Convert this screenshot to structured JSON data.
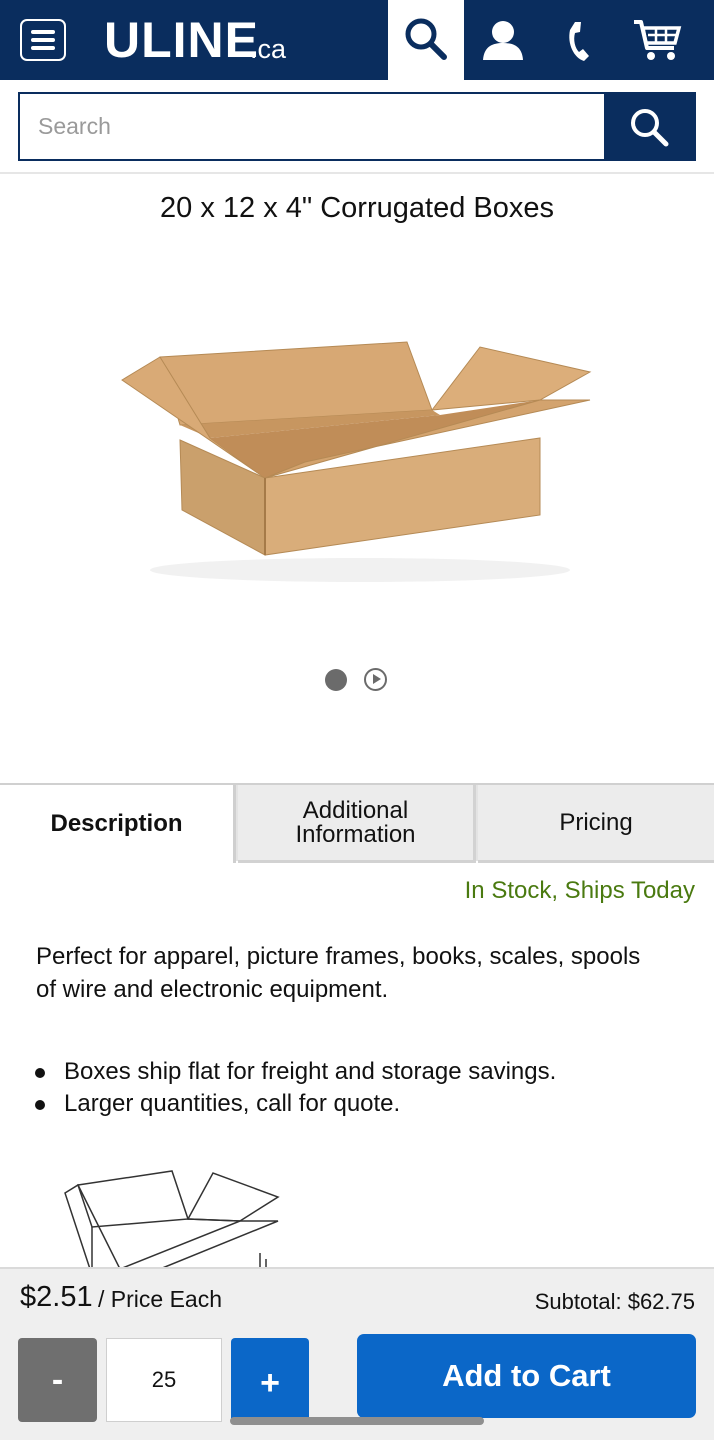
{
  "header": {
    "logo_text": "ULINE",
    "logo_suffix": ".ca",
    "icons": [
      "menu-icon",
      "search-icon",
      "account-icon",
      "phone-icon",
      "cart-icon"
    ],
    "brand_color": "#0a2d5e"
  },
  "search": {
    "placeholder": "Search",
    "value": ""
  },
  "product": {
    "title": "20 x 12 x 4\" Corrugated Boxes",
    "image": "cardboard-box-image",
    "carousel": {
      "slides": [
        "image",
        "video"
      ],
      "active_index": 0
    }
  },
  "tabs": [
    {
      "label": "Description",
      "active": true
    },
    {
      "label": "Additional Information",
      "active": false
    },
    {
      "label": "Pricing",
      "active": false
    }
  ],
  "details": {
    "stock_status": "In Stock, Ships Today",
    "stock_color": "#4a7a10",
    "description": "Perfect for apparel, picture frames, books, scales, spools of wire and electronic equipment.",
    "bullets": [
      "Boxes ship flat for freight and storage savings.",
      "Larger quantities, call for quote."
    ]
  },
  "purchase": {
    "price": "$2.51",
    "price_label": "/ Price Each",
    "subtotal": "Subtotal: $62.75",
    "decrement_label": "-",
    "quantity": "25",
    "increment_label": "+",
    "add_to_cart_label": "Add to Cart",
    "accent_color": "#0b67c8"
  }
}
